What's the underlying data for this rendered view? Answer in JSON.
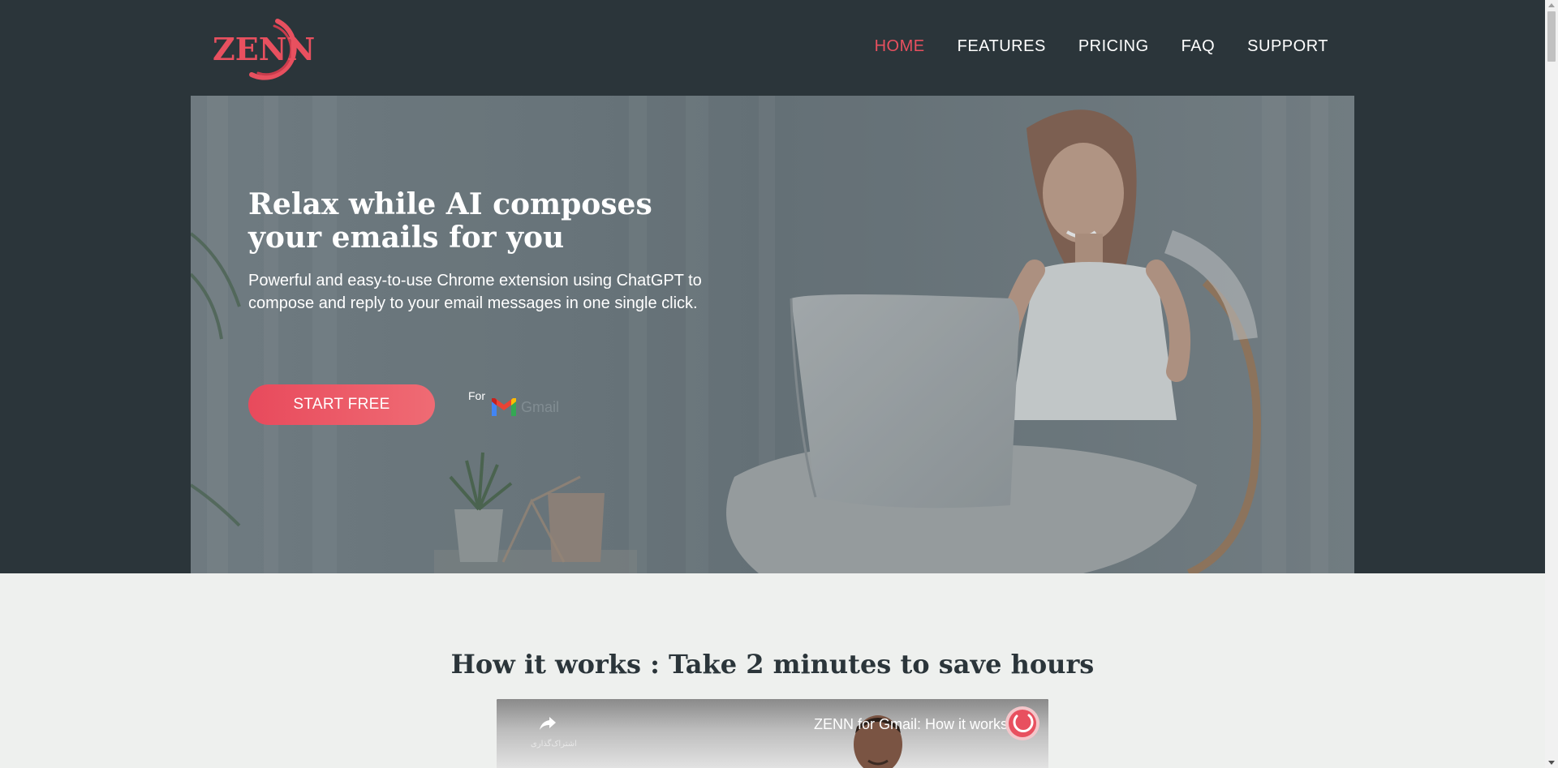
{
  "header": {
    "logo_text": "ZENN",
    "nav": [
      {
        "label": "HOME",
        "active": true
      },
      {
        "label": "FEATURES",
        "active": false
      },
      {
        "label": "PRICING",
        "active": false
      },
      {
        "label": "FAQ",
        "active": false
      },
      {
        "label": "SUPPORT",
        "active": false
      }
    ]
  },
  "hero": {
    "title_line1": "Relax while AI composes",
    "title_line2": "your emails for you",
    "subtitle_line1": "Powerful and easy-to-use Chrome extension using ChatGPT to",
    "subtitle_line2": "compose and reply to your email messages in one single click.",
    "cta_label": "START FREE",
    "for_label": "For",
    "gmail_word": "Gmail"
  },
  "how_it_works": {
    "title": "How it works : Take 2 minutes to save hours",
    "video": {
      "title": "ZENN for Gmail: How it works",
      "share_label": "اشتراک‌گذاری"
    }
  },
  "colors": {
    "header_bg": "#2b353a",
    "accent": "#e8505f",
    "page_bg": "#eef0ee"
  },
  "icons": [
    "zenn-logo-icon",
    "gmail-icon",
    "share-icon",
    "channel-logo-icon"
  ]
}
